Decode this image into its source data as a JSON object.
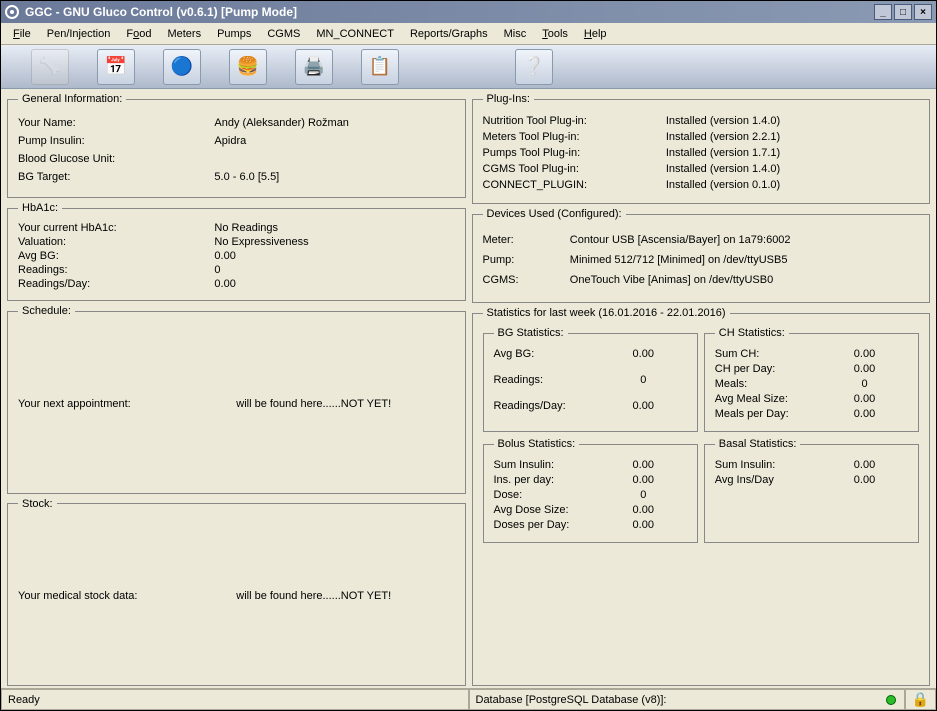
{
  "window": {
    "title": "GGC - GNU Gluco Control (v0.6.1) [Pump Mode]"
  },
  "menu": {
    "file": "File",
    "pen": "Pen/Injection",
    "food": "Food",
    "meters": "Meters",
    "pumps": "Pumps",
    "cgms": "CGMS",
    "mnconnect": "MN_CONNECT",
    "reports": "Reports/Graphs",
    "misc": "Misc",
    "tools": "Tools",
    "help": "Help"
  },
  "general": {
    "legend": "General Information:",
    "name_label": "Your Name:",
    "name_value": "Andy (Aleksander) Rožman",
    "pump_label": "Pump Insulin:",
    "pump_value": "Apidra",
    "bgu_label": "Blood Glucose Unit:",
    "bgu_value": "",
    "bgt_label": "BG Target:",
    "bgt_value": "5.0 - 6.0 [5.5]"
  },
  "hba1c": {
    "legend": "HbA1c:",
    "cur_label": "Your current HbA1c:",
    "cur_value": "No Readings",
    "val_label": "Valuation:",
    "val_value": "No Expressiveness",
    "avg_label": "Avg BG:",
    "avg_value": "0.00",
    "read_label": "Readings:",
    "read_value": "0",
    "rpd_label": "Readings/Day:",
    "rpd_value": "0.00"
  },
  "schedule": {
    "legend": "Schedule:",
    "label": "Your next appointment:",
    "value": "will be found here......NOT YET!"
  },
  "stock": {
    "legend": "Stock:",
    "label": "Your medical stock data:",
    "value": "will be found here......NOT YET!"
  },
  "plugins": {
    "legend": "Plug-Ins:",
    "items": [
      {
        "label": "Nutrition Tool Plug-in:",
        "value": "Installed (version 1.4.0)"
      },
      {
        "label": "Meters Tool Plug-in:",
        "value": "Installed (version 2.2.1)"
      },
      {
        "label": "Pumps Tool Plug-in:",
        "value": "Installed (version 1.7.1)"
      },
      {
        "label": "CGMS Tool Plug-in:",
        "value": "Installed (version 1.4.0)"
      },
      {
        "label": "CONNECT_PLUGIN:",
        "value": "Installed (version 0.1.0)"
      }
    ]
  },
  "devices": {
    "legend": "Devices Used (Configured):",
    "meter_label": "Meter:",
    "meter_value": "Contour USB [Ascensia/Bayer] on 1a79:6002",
    "pump_label": "Pump:",
    "pump_value": "Minimed 512/712 [Minimed] on /dev/ttyUSB5",
    "cgms_label": "CGMS:",
    "cgms_value": "OneTouch Vibe [Animas] on /dev/ttyUSB0"
  },
  "stats": {
    "legend": "Statistics for last week (16.01.2016 - 22.01.2016)",
    "bg": {
      "legend": "BG Statistics:",
      "avg_label": "Avg BG:",
      "avg_value": "0.00",
      "read_label": "Readings:",
      "read_value": "0",
      "rpd_label": "Readings/Day:",
      "rpd_value": "0.00"
    },
    "ch": {
      "legend": "CH Statistics:",
      "sum_label": "Sum CH:",
      "sum_value": "0.00",
      "pd_label": "CH per Day:",
      "pd_value": "0.00",
      "meals_label": "Meals:",
      "meals_value": "0",
      "ams_label": "Avg Meal Size:",
      "ams_value": "0.00",
      "mpd_label": "Meals per Day:",
      "mpd_value": "0.00"
    },
    "bolus": {
      "legend": "Bolus Statistics:",
      "sum_label": "Sum Insulin:",
      "sum_value": "0.00",
      "ipd_label": "Ins. per day:",
      "ipd_value": "0.00",
      "dose_label": "Dose:",
      "dose_value": "0",
      "ads_label": "Avg Dose Size:",
      "ads_value": "0.00",
      "dpd_label": "Doses per Day:",
      "dpd_value": "0.00"
    },
    "basal": {
      "legend": "Basal Statistics:",
      "sum_label": "Sum Insulin:",
      "sum_value": "0.00",
      "aipd_label": "Avg Ins/Day",
      "aipd_value": "0.00"
    }
  },
  "status": {
    "left": "Ready",
    "right": "Database [PostgreSQL Database (v8)]:"
  }
}
